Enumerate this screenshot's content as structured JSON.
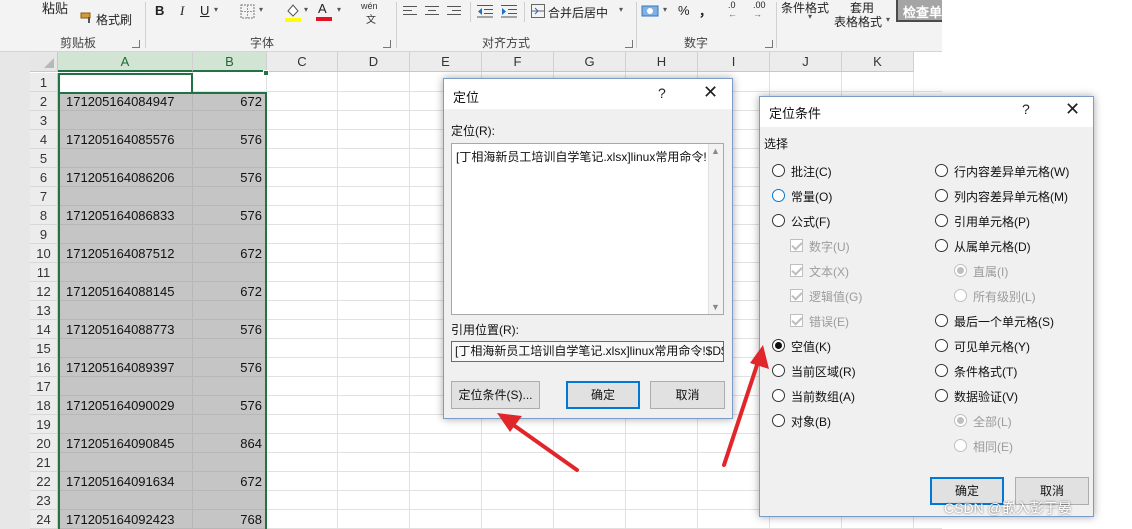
{
  "ribbon": {
    "paste_label": "粘贴",
    "format_painter_label": "格式刷",
    "clipboard_group": "剪贴板",
    "font_group": "字体",
    "alignment_group": "对齐方式",
    "number_group": "数字",
    "merge_center_label": "合并后居中",
    "bold": "B",
    "italic": "I",
    "underline": "U",
    "font_color_letter": "A",
    "percent": "%",
    "comma": "，",
    "conditional_format_label": "条件格式",
    "table_format_line1": "套用",
    "table_format_line2": "表格格式",
    "check_cell_label": "检查单",
    "wen_label": "wén",
    "decimal_increase": ".00",
    "decimal_decrease": ".0",
    "colors": {
      "font_color_bar": "#e81123",
      "fill_color_bar": "#ffff00"
    }
  },
  "sheet": {
    "columns": [
      "A",
      "B",
      "C",
      "D",
      "E",
      "F",
      "G",
      "H",
      "I",
      "J",
      "K"
    ],
    "rows": [
      "1",
      "2",
      "3",
      "4",
      "5",
      "6",
      "7",
      "8",
      "9",
      "10",
      "11",
      "12",
      "13",
      "14",
      "15",
      "16",
      "17",
      "18",
      "19",
      "20",
      "21",
      "22",
      "23",
      "24"
    ],
    "data_rows": [
      {
        "row": "2",
        "a": "171205164084947",
        "b": "672"
      },
      {
        "row": "4",
        "a": "171205164085576",
        "b": "576"
      },
      {
        "row": "6",
        "a": "171205164086206",
        "b": "576"
      },
      {
        "row": "8",
        "a": "171205164086833",
        "b": "576"
      },
      {
        "row": "10",
        "a": "171205164087512",
        "b": "672"
      },
      {
        "row": "12",
        "a": "171205164088145",
        "b": "672"
      },
      {
        "row": "14",
        "a": "171205164088773",
        "b": "576"
      },
      {
        "row": "16",
        "a": "171205164089397",
        "b": "576"
      },
      {
        "row": "18",
        "a": "171205164090029",
        "b": "576"
      },
      {
        "row": "20",
        "a": "171205164090845",
        "b": "864"
      },
      {
        "row": "22",
        "a": "171205164091634",
        "b": "672"
      },
      {
        "row": "24",
        "a": "171205164092423",
        "b": "768"
      }
    ],
    "selection_color": "#217346"
  },
  "goto_dialog": {
    "title": "定位",
    "help": "?",
    "close": "✕",
    "goto_label": "定位(R):",
    "list_item": "[丁相海新员工培训自学笔记.xlsx]linux常用命令!$",
    "reference_label": "引用位置(R):",
    "reference_value": "[丁相海新员工培训自学笔记.xlsx]linux常用命令!$D$",
    "special_button": "定位条件(S)...",
    "ok_button": "确定",
    "cancel_button": "取消"
  },
  "special_dialog": {
    "title": "定位条件",
    "help": "?",
    "close": "✕",
    "section_label": "选择",
    "left_options": [
      {
        "label": "批注(C)",
        "kind": "radio"
      },
      {
        "label": "常量(O)",
        "kind": "radio"
      },
      {
        "label": "公式(F)",
        "kind": "radio"
      },
      {
        "label": "数字(U)",
        "kind": "check"
      },
      {
        "label": "文本(X)",
        "kind": "check"
      },
      {
        "label": "逻辑值(G)",
        "kind": "check"
      },
      {
        "label": "错误(E)",
        "kind": "check"
      },
      {
        "label": "空值(K)",
        "kind": "radio",
        "checked": true
      },
      {
        "label": "当前区域(R)",
        "kind": "radio"
      },
      {
        "label": "当前数组(A)",
        "kind": "radio"
      },
      {
        "label": "对象(B)",
        "kind": "radio"
      }
    ],
    "right_options": [
      {
        "label": "行内容差异单元格(W)",
        "kind": "radio"
      },
      {
        "label": "列内容差异单元格(M)",
        "kind": "radio"
      },
      {
        "label": "引用单元格(P)",
        "kind": "radio"
      },
      {
        "label": "从属单元格(D)",
        "kind": "radio"
      },
      {
        "label": "直属(I)",
        "kind": "subradio",
        "checked": true
      },
      {
        "label": "所有级别(L)",
        "kind": "subradio"
      },
      {
        "label": "最后一个单元格(S)",
        "kind": "radio"
      },
      {
        "label": "可见单元格(Y)",
        "kind": "radio"
      },
      {
        "label": "条件格式(T)",
        "kind": "radio"
      },
      {
        "label": "数据验证(V)",
        "kind": "radio"
      },
      {
        "label": "全部(L)",
        "kind": "subradio",
        "checked": true
      },
      {
        "label": "相同(E)",
        "kind": "subradio"
      }
    ],
    "ok_button": "确定",
    "cancel_button": "取消"
  },
  "annotation": {
    "arrow_color": "#e0262b",
    "watermark": "CSDN @嵌入彭于晏"
  }
}
